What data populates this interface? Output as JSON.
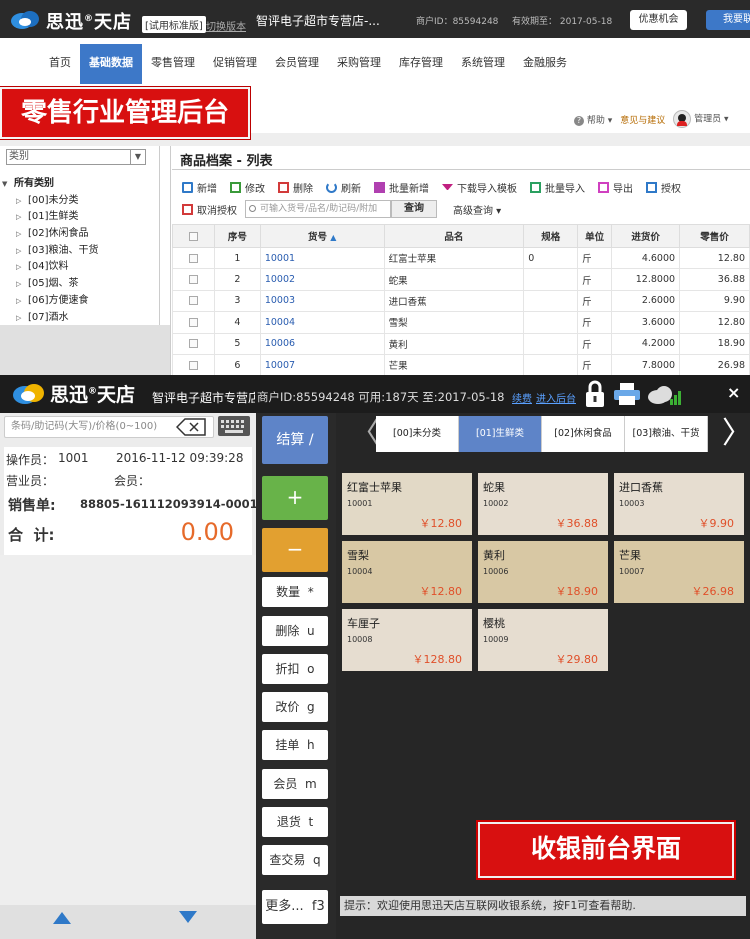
{
  "brand": {
    "name_cn": "思迅",
    "name_shop": "天店",
    "trial_label": "[试用标准版]",
    "switch_label": "切换版本"
  },
  "backoffice": {
    "store_name": "智评电子超市专营店-...",
    "merchant_id": "商户ID：85594248",
    "expiry": "有效期至：  2017-05-18",
    "offer_button": "优惠机会",
    "contact_button": "我要联",
    "nav": [
      "首页",
      "基础数据",
      "零售管理",
      "促销管理",
      "会员管理",
      "采购管理",
      "库存管理",
      "系统管理",
      "金融服务"
    ],
    "banner": "零售行业管理后台",
    "util": {
      "help": "帮助",
      "feedback": "意见与建议",
      "user": "管理员"
    },
    "category_select": "类别",
    "tree_root": "所有类别",
    "tree_items": [
      "[00]未分类",
      "[01]生鲜类",
      "[02]休闲食品",
      "[03]粮油、干货",
      "[04]饮料",
      "[05]烟、茶",
      "[06]方便速食",
      "[07]酒水"
    ],
    "panel_title": "商品档案 - 列表",
    "toolbar1": [
      "新增",
      "修改",
      "删除",
      "刷新",
      "批量新增",
      "下载导入模板",
      "批量导入",
      "导出",
      "授权"
    ],
    "toolbar2": {
      "cancel_auth": "取消授权",
      "search_placeholder": "可输入货号/品名/助记码/附加",
      "query": "查询",
      "advanced": "高级查询"
    },
    "columns": [
      "序号",
      "货号",
      "品名",
      "规格",
      "单位",
      "进货价",
      "零售价"
    ],
    "rows": [
      {
        "idx": "1",
        "code": "10001",
        "name": "红富士苹果",
        "spec": "0",
        "unit": "斤",
        "cost": "4.6000",
        "price": "12.80"
      },
      {
        "idx": "2",
        "code": "10002",
        "name": "蛇果",
        "spec": "",
        "unit": "斤",
        "cost": "12.8000",
        "price": "36.88"
      },
      {
        "idx": "3",
        "code": "10003",
        "name": "进口香蕉",
        "spec": "",
        "unit": "斤",
        "cost": "2.6000",
        "price": "9.90"
      },
      {
        "idx": "4",
        "code": "10004",
        "name": "雪梨",
        "spec": "",
        "unit": "斤",
        "cost": "3.6000",
        "price": "12.80"
      },
      {
        "idx": "5",
        "code": "10006",
        "name": "黄利",
        "spec": "",
        "unit": "斤",
        "cost": "4.2000",
        "price": "18.90"
      },
      {
        "idx": "6",
        "code": "10007",
        "name": "芒果",
        "spec": "",
        "unit": "斤",
        "cost": "7.8000",
        "price": "26.98"
      }
    ]
  },
  "pos": {
    "store_name": "智评电子超市专营店",
    "info": "商户ID:85594248 可用:187天 至:2017-05-18",
    "renew": "续费",
    "enter_backoffice": "进入后台",
    "close": "×",
    "scan_placeholder": "条码/助记码(大写)/价格(0~100)",
    "operator_label": "操作员：",
    "operator": "1001",
    "datetime": "2016-11-12 09:39:28",
    "sales_label": "营业员：",
    "member_label": "会员：",
    "order_label": "销售单:",
    "order_no": "88805-161112093914-0001",
    "total_label": "合  计:",
    "total": "0.00",
    "settle": "结算 /",
    "plus": "+",
    "minus": "−",
    "funcs": [
      "数量  *",
      "删除  u",
      "折扣  o",
      "改价  g",
      "挂单  h",
      "会员  m",
      "退货  t",
      "查交易  q"
    ],
    "more": "更多...  f3",
    "tabs": [
      "[00]未分类",
      "[01]生鲜类",
      "[02]休闲食品",
      "[03]粮油、干货"
    ],
    "products": [
      {
        "name": "红富士苹果",
        "code": "10001",
        "price": "￥12.80"
      },
      {
        "name": "蛇果",
        "code": "10002",
        "price": "￥36.88"
      },
      {
        "name": "进口香蕉",
        "code": "10003",
        "price": "￥9.90"
      },
      {
        "name": "雪梨",
        "code": "10004",
        "price": "￥12.80"
      },
      {
        "name": "黄利",
        "code": "10006",
        "price": "￥18.90"
      },
      {
        "name": "芒果",
        "code": "10007",
        "price": "￥26.98"
      },
      {
        "name": "车厘子",
        "code": "10008",
        "price": "￥128.80"
      },
      {
        "name": "樱桃",
        "code": "10009",
        "price": "￥29.80"
      }
    ],
    "banner": "收银前台界面",
    "tip": "提示：欢迎使用思迅天店互联网收银系统，按F1可查看帮助."
  },
  "colors": {
    "accent_blue": "#3d78c8",
    "banner_red": "#d81010",
    "price_orange": "#e0502a",
    "green": "#68b349",
    "orange": "#e2a030"
  }
}
